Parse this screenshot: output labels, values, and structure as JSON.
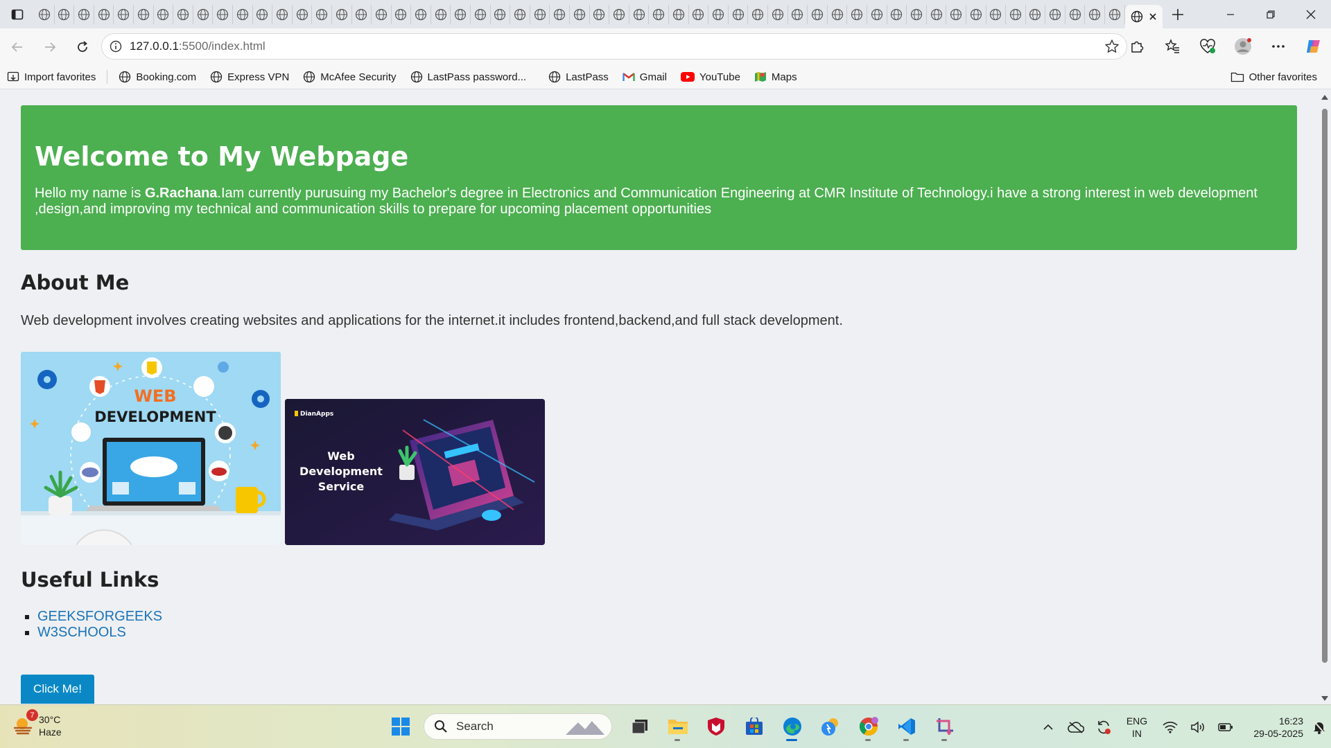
{
  "browser": {
    "url_host": "127.0.0.1",
    "url_path": ":5500/index.html",
    "bookmarks": [
      {
        "label": "Import favorites",
        "icon": "import-icon"
      },
      {
        "label": "Booking.com",
        "icon": "globe-icon"
      },
      {
        "label": "Express VPN",
        "icon": "globe-icon"
      },
      {
        "label": "McAfee Security",
        "icon": "globe-icon"
      },
      {
        "label": "LastPass password...",
        "icon": "globe-icon"
      },
      {
        "label": "LastPass",
        "icon": "globe-icon"
      },
      {
        "label": "Gmail",
        "icon": "gmail-icon"
      },
      {
        "label": "YouTube",
        "icon": "youtube-icon"
      },
      {
        "label": "Maps",
        "icon": "maps-icon"
      }
    ],
    "other_favorites": "Other favorites"
  },
  "page": {
    "hero": {
      "title": "Welcome to My Webpage",
      "intro_prefix": "Hello my name is ",
      "name": "G.Rachana",
      "intro_suffix": ".Iam currently purusuing my Bachelor's degree in Electronics and Communication Engineering at CMR Institute of Technology.i have a strong interest in web development ,design,and improving my technical and communication skills to prepare for upcoming placement opportunities"
    },
    "about": {
      "heading": "About Me",
      "text": "Web development involves creating websites and applications for the internet.it includes frontend,backend,and full stack development."
    },
    "image1": {
      "line1": "WEB",
      "line2": "DEVELOPMENT"
    },
    "image2": {
      "brand": "DianApps",
      "line1": "Web",
      "line2": "Development",
      "line3": "Service"
    },
    "links": {
      "heading": "Useful Links",
      "items": [
        "GEEKSFORGEEKS",
        "W3SCHOOLS"
      ]
    },
    "button_label": "Click Me!"
  },
  "taskbar": {
    "weather_temp": "30°C",
    "weather_desc": "Haze",
    "weather_badge": "7",
    "search_placeholder": "Search",
    "lang_line1": "ENG",
    "lang_line2": "IN",
    "time": "16:23",
    "date": "29-05-2025"
  },
  "colors": {
    "hero_bg": "#4caf50",
    "link": "#1a73b8",
    "button_bg": "#0a88c6"
  }
}
